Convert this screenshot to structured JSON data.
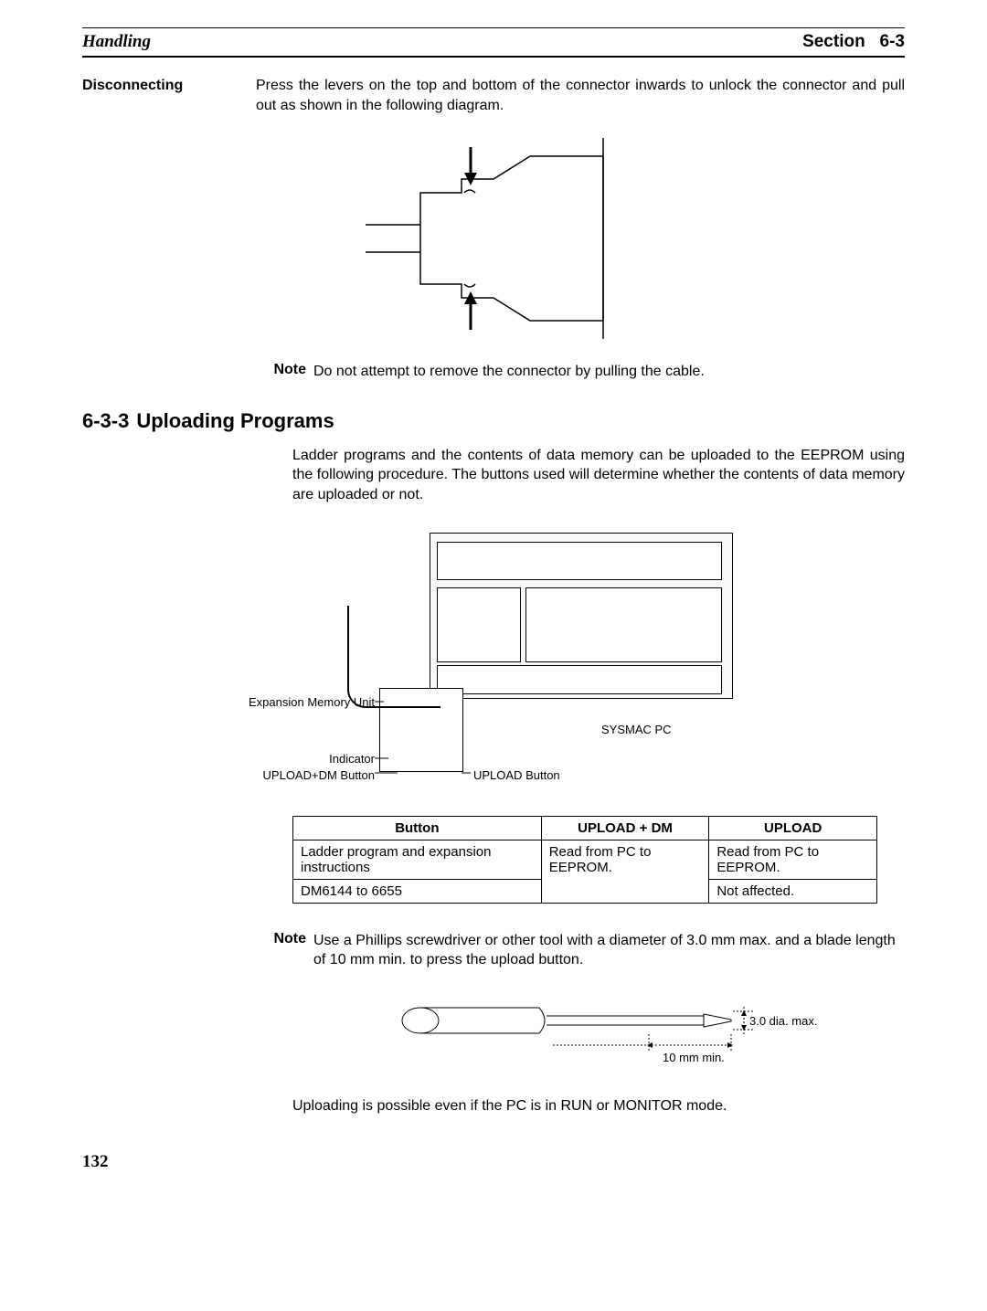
{
  "header": {
    "left": "Handling",
    "section_label": "Section",
    "section_num": "6-3"
  },
  "disconnecting": {
    "heading": "Disconnecting",
    "body": "Press the levers on the top and bottom of the connector inwards to unlock the connector and pull out as shown in the following diagram.",
    "note_label": "Note",
    "note_body": "Do not attempt to remove the connector by pulling the cable."
  },
  "uploading": {
    "num": "6-3-3",
    "title": "Uploading Programs",
    "body": "Ladder programs and the contents of data memory can be uploaded to the EEPROM using the following procedure. The buttons used will determine whether the contents of data memory are uploaded or not.",
    "labels": {
      "exp_mem_unit": "Expansion Memory Unit",
      "indicator": "Indicator",
      "upload_dm_button": "UPLOAD+DM Button",
      "upload_button": "UPLOAD Button",
      "sysmac_pc": "SYSMAC PC"
    },
    "table": {
      "headers": [
        "Button",
        "UPLOAD + DM",
        "UPLOAD"
      ],
      "rows": [
        {
          "c0": "Ladder program and expansion instructions",
          "c1": "Read from PC to EEPROM.",
          "c2": "Read from PC to EEPROM."
        },
        {
          "c0": "DM6144 to 6655",
          "c1": "",
          "c2": "Not affected."
        }
      ]
    },
    "note_label": "Note",
    "note_body": "Use a Phillips screwdriver or other tool with a diameter of 3.0 mm max. and a blade length of 10 mm min. to press the upload button.",
    "screwdriver": {
      "dia_label": "3.0 dia. max.",
      "len_label": "10 mm min."
    },
    "closing": "Uploading is possible even if the PC is in RUN or MONITOR mode."
  },
  "page_number": "132"
}
